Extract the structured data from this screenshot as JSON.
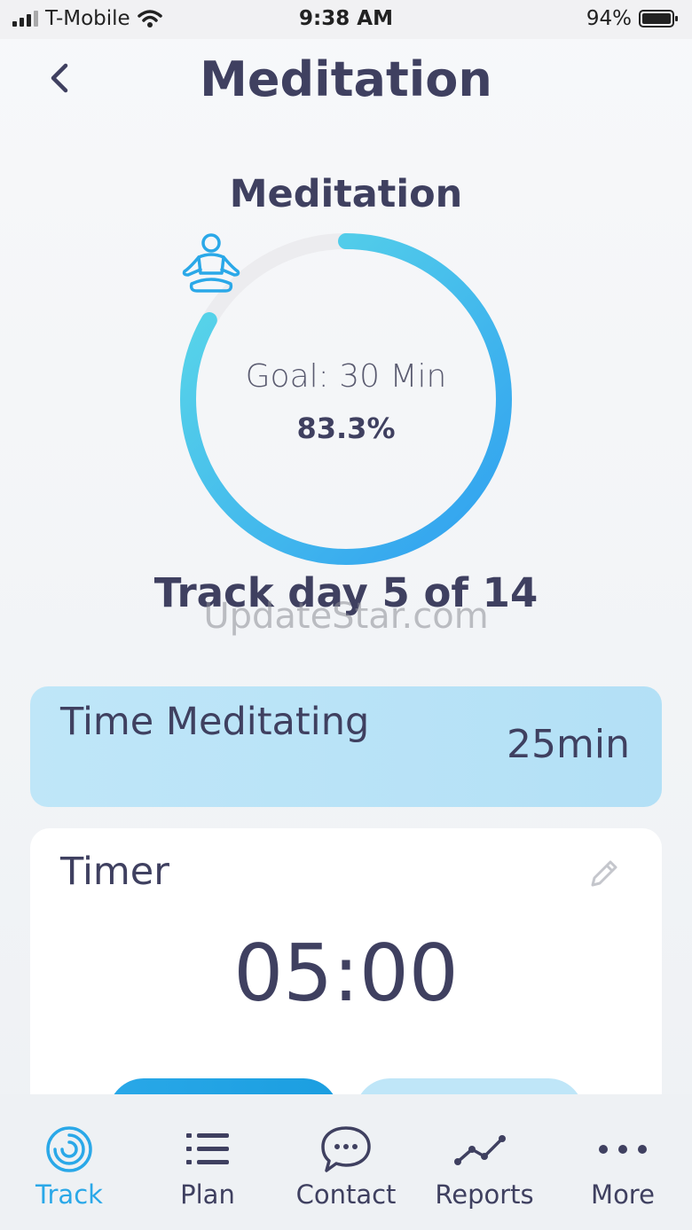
{
  "status_bar": {
    "carrier": "T-Mobile",
    "time": "9:38 AM",
    "battery": "94%"
  },
  "header": {
    "title": "Meditation",
    "back_icon": "chevron-left-icon"
  },
  "progress": {
    "section_title": "Meditation",
    "icon": "meditation-icon",
    "goal_text": "Goal: 30 Min",
    "percent_text": "83.3%",
    "percent_value": 0.833,
    "track_day_text": "Track day 5 of 14",
    "colors": {
      "ring_start": "#2f9ff0",
      "ring_end": "#5ddbe8",
      "ring_track": "#ececef"
    }
  },
  "watermark": "UpdateStar.com",
  "time_card": {
    "label": "Time Meditating",
    "value": "25min"
  },
  "timer_card": {
    "label": "Timer",
    "value": "05:00",
    "edit_icon": "pencil-icon"
  },
  "tabs": [
    {
      "label": "Track",
      "icon": "track-icon",
      "active": true
    },
    {
      "label": "Plan",
      "icon": "list-icon",
      "active": false
    },
    {
      "label": "Contact",
      "icon": "chat-icon",
      "active": false
    },
    {
      "label": "Reports",
      "icon": "chart-line-icon",
      "active": false
    },
    {
      "label": "More",
      "icon": "more-icon",
      "active": false
    }
  ],
  "colors": {
    "accent": "#2aa8e8",
    "text": "#3f4060",
    "card_blue": "#bfe6f8"
  }
}
